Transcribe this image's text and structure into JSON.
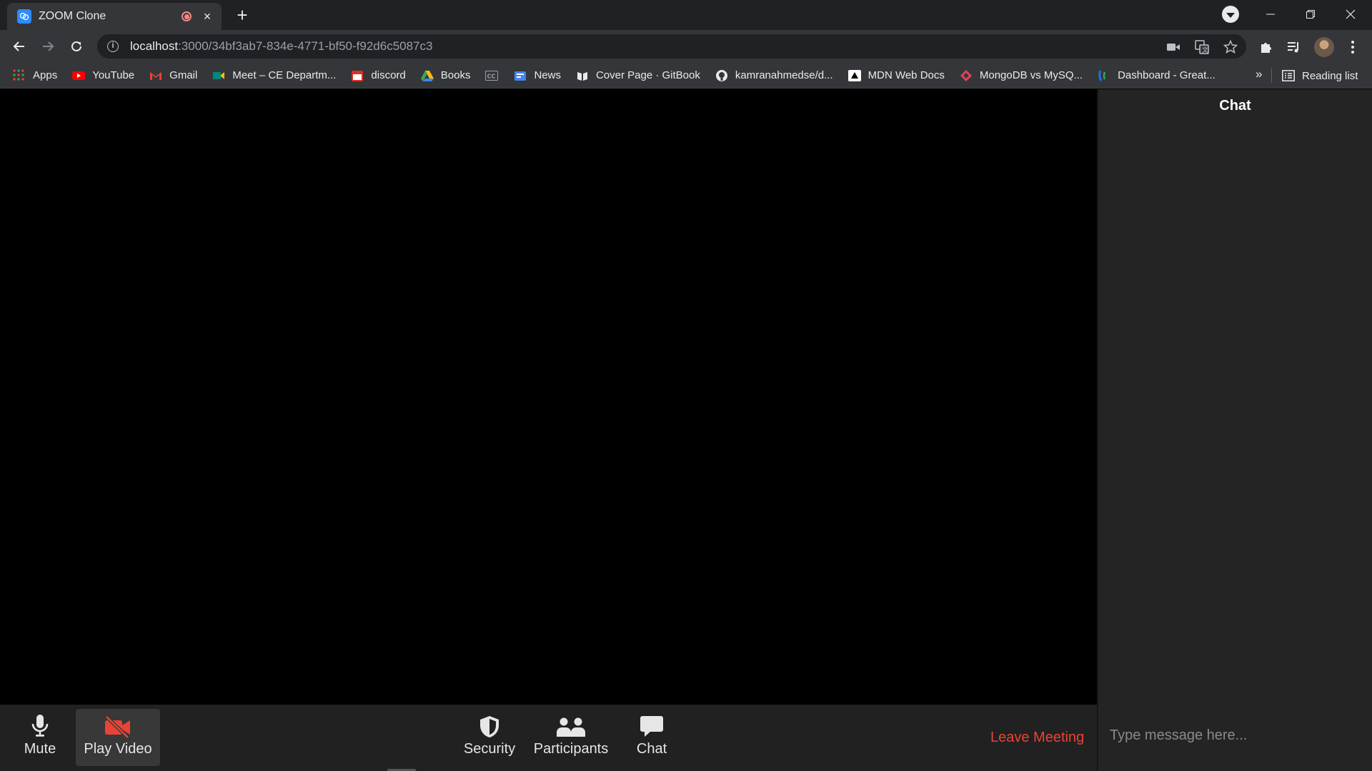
{
  "browser": {
    "tab": {
      "title": "ZOOM Clone",
      "close_glyph": "×",
      "favicon": "zoom-clone-icon"
    },
    "new_tab_glyph": "+",
    "url": {
      "host": "localhost",
      "path": ":3000/34bf3ab7-834e-4771-bf50-f92d6c5087c3"
    },
    "bookmarks": [
      {
        "label": "Apps",
        "icon": "apps-grid-icon",
        "color": "#4285f4"
      },
      {
        "label": "YouTube",
        "icon": "youtube-icon",
        "color": "#ff0000"
      },
      {
        "label": "Gmail",
        "icon": "gmail-icon",
        "color": "#ea4335"
      },
      {
        "label": "Meet – CE Departm...",
        "icon": "google-meet-icon",
        "color": "#00897b"
      },
      {
        "label": "discord",
        "icon": "calendar-icon",
        "color": "#d93025"
      },
      {
        "label": "Books",
        "icon": "google-drive-icon",
        "color": "#34a853"
      },
      {
        "label": "",
        "icon": "cc-icon",
        "color": "#9aa0a6"
      },
      {
        "label": "News",
        "icon": "google-news-icon",
        "color": "#4285f4"
      },
      {
        "label": "Cover Page · GitBook",
        "icon": "gitbook-icon",
        "color": "#e8eaed"
      },
      {
        "label": "kamranahmedse/d...",
        "icon": "github-icon",
        "color": "#e8eaed"
      },
      {
        "label": "MDN Web Docs",
        "icon": "mdn-icon",
        "color": "#ffffff"
      },
      {
        "label": "MongoDB vs MySQ...",
        "icon": "mongodb-icon",
        "color": "#e8405a"
      },
      {
        "label": "Dashboard - Great...",
        "icon": "dashboard-icon",
        "color": "#1a73e8"
      }
    ],
    "more_glyph": "»",
    "reading_list": "Reading list"
  },
  "meeting": {
    "controls": {
      "mute": "Mute",
      "play_video": "Play Video",
      "security": "Security",
      "participants": "Participants",
      "chat": "Chat"
    },
    "leave": "Leave Meeting",
    "accent_danger": "#ea4335"
  },
  "chat": {
    "title": "Chat",
    "placeholder": "Type message here..."
  }
}
